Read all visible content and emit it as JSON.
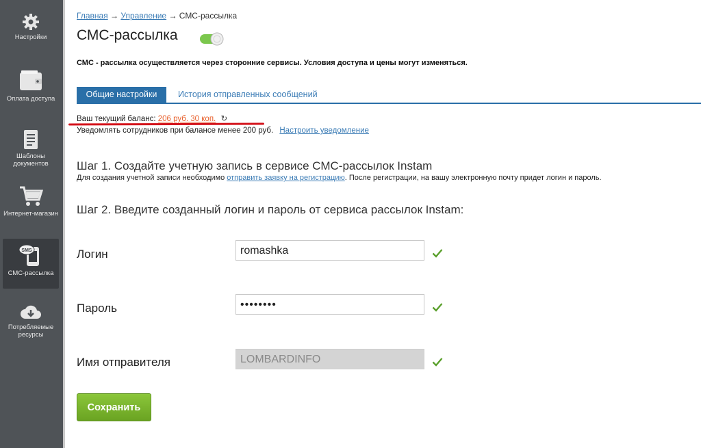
{
  "sidebar": {
    "items": [
      {
        "label": "Настройки",
        "icon": "gear-icon"
      },
      {
        "label": "Оплата доступа",
        "icon": "wallet-icon"
      },
      {
        "label": "Шаблоны документов",
        "icon": "document-icon"
      },
      {
        "label": "Интернет-магазин",
        "icon": "cart-icon"
      },
      {
        "label": "СМС-рассылка",
        "icon": "sms-phone-icon",
        "active": true
      },
      {
        "label": "Потребляемые ресурсы",
        "icon": "cloud-download-icon"
      }
    ]
  },
  "breadcrumb": {
    "home": "Главная",
    "sep1": "→",
    "manage": "Управление",
    "sep2": "→",
    "current": "СМС-рассылка"
  },
  "page": {
    "title": "СМС-рассылка",
    "toggle_on": true,
    "notice": "СМС - рассылка осуществляется через сторонние сервисы. Условия доступа и цены могут изменяться."
  },
  "tabs": {
    "active": "Общие настройки",
    "history": "История отправленных сообщений"
  },
  "balance": {
    "label": "Ваш текущий баланс:",
    "amount": "206 руб. 30 коп.",
    "refresh_glyph": "↻"
  },
  "notify": {
    "text": "Уведомлять сотрудников при балансе менее 200 руб.",
    "link": "Настроить уведомление"
  },
  "step1": {
    "title": "Шаг 1. Создайте учетную запись в сервисе СМС-рассылок Instam",
    "desc_before": "Для создания учетной записи необходимо",
    "desc_link": "отправить заявку на регистрацию",
    "desc_after": ". После регистрации, на вашу электронную почту придет логин и пароль."
  },
  "step2": {
    "title": "Шаг 2. Введите созданный логин и пароль от сервиса рассылок Instam:"
  },
  "form": {
    "login_label": "Логин",
    "login_value": "romashka",
    "password_label": "Пароль",
    "password_value": "••••••••",
    "sender_label": "Имя отправителя",
    "sender_value": "LOMBARDINFO",
    "check_color": "#5aa02c"
  },
  "save_button": "Сохранить"
}
